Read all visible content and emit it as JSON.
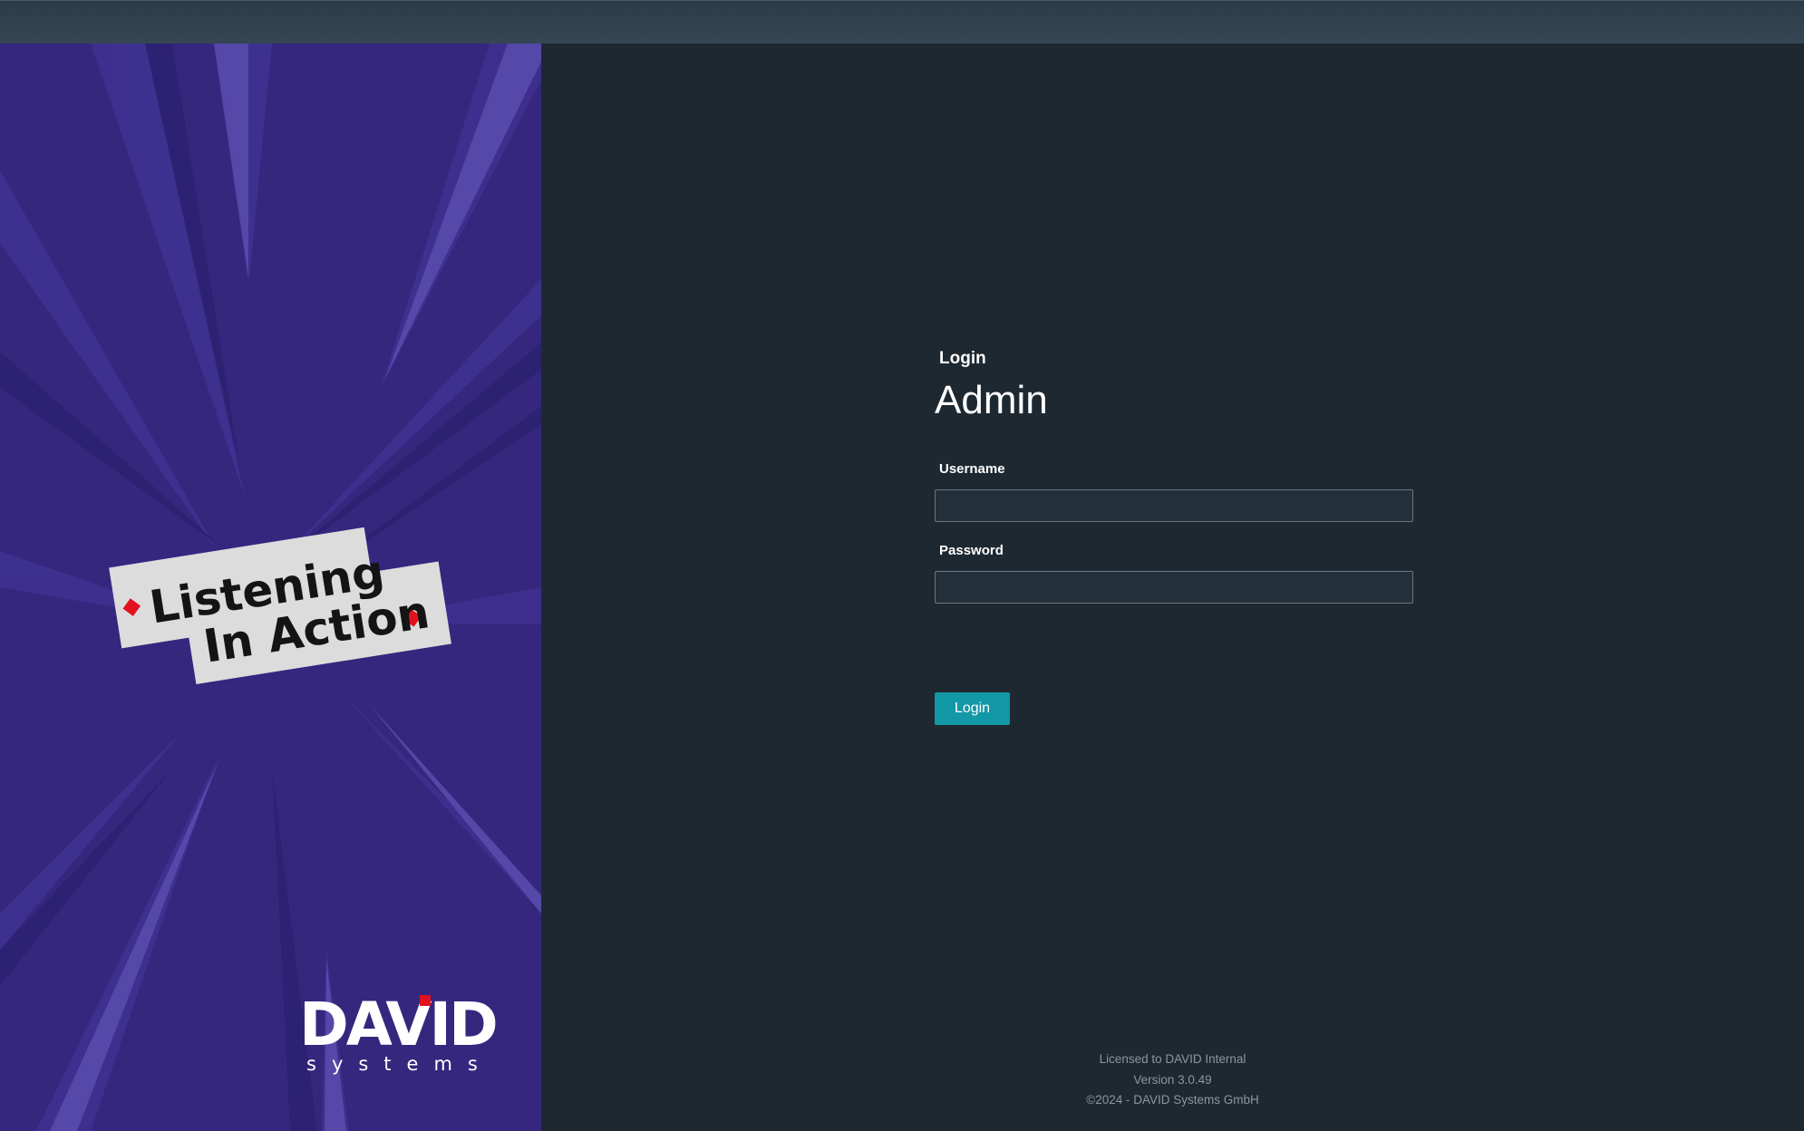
{
  "branding": {
    "banner_line1": "Listening",
    "banner_line2": "In Action",
    "logo_name": "DAVID",
    "logo_sub": "systems",
    "logo_accent": "#e3101e",
    "panel_color": "#35277e"
  },
  "login": {
    "section_label": "Login",
    "title": "Admin",
    "username_label": "Username",
    "username_value": "",
    "password_label": "Password",
    "password_value": "",
    "button_label": "Login",
    "button_color": "#1298a6"
  },
  "footer": {
    "license": "Licensed to DAVID Internal",
    "version": "Version 3.0.49",
    "copyright": "©2024 - DAVID Systems GmbH"
  }
}
